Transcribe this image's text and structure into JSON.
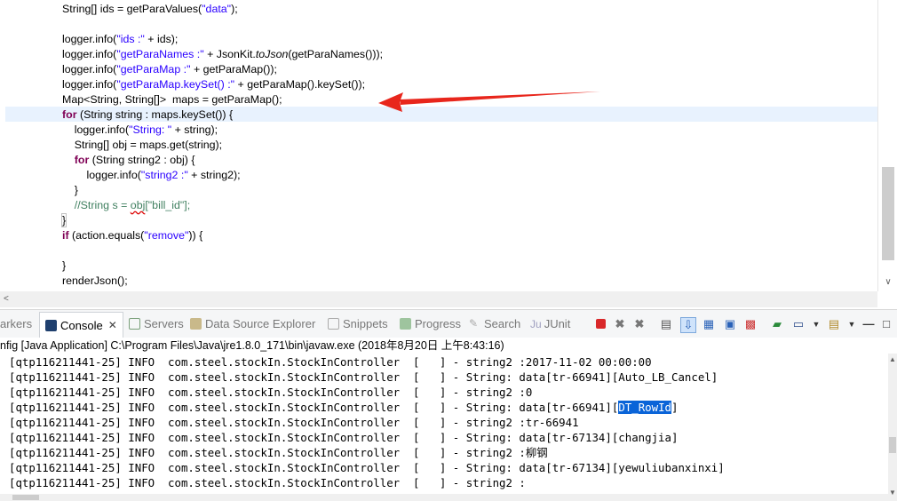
{
  "editor": {
    "lines": [
      "String[] ids = getParaValues(\"data\");",
      "",
      "logger.info(\"ids :\" + ids);",
      "logger.info(\"getParaNames :\" + JsonKit.toJson(getParaNames()));",
      "logger.info(\"getParaMap :\" + getParaMap());",
      "logger.info(\"getParaMap.keySet() :\" + getParaMap().keySet());",
      "Map<String, String[]>  maps = getParaMap();",
      "for (String string : maps.keySet()) {",
      "    logger.info(\"String: \" + string);",
      "    String[] obj = maps.get(string);",
      "    for (String string2 : obj) {",
      "        logger.info(\"string2 :\" + string2);",
      "    }",
      "    //String s = obj[\"bill_id\"];",
      "}",
      "if (action.equals(\"remove\")) {",
      "",
      "}",
      "renderJson();"
    ]
  },
  "tabs": {
    "markers": "arkers",
    "console": "Console",
    "servers": "Servers",
    "data_source_explorer": "Data Source Explorer",
    "snippets": "Snippets",
    "progress": "Progress",
    "search": "Search",
    "junit": "JUnit",
    "junit_icon_text": "Ju"
  },
  "console": {
    "title": "nfig [Java Application] C:\\Program Files\\Java\\jre1.8.0_171\\bin\\javaw.exe (2018年8月20日 上午8:43:16)",
    "lines": [
      "[qtp116211441-25] INFO  com.steel.stockIn.StockInController  [   ] - string2 :2017-11-02 00:00:00",
      "[qtp116211441-25] INFO  com.steel.stockIn.StockInController  [   ] - String: data[tr-66941][Auto_LB_Cancel]",
      "[qtp116211441-25] INFO  com.steel.stockIn.StockInController  [   ] - string2 :0",
      "[qtp116211441-25] INFO  com.steel.stockIn.StockInController  [   ] - String: data[tr-66941][",
      "[qtp116211441-25] INFO  com.steel.stockIn.StockInController  [   ] - string2 :tr-66941",
      "[qtp116211441-25] INFO  com.steel.stockIn.StockInController  [   ] - String: data[tr-67134][changjia]",
      "[qtp116211441-25] INFO  com.steel.stockIn.StockInController  [   ] - string2 :柳钢",
      "[qtp116211441-25] INFO  com.steel.stockIn.StockInController  [   ] - String: data[tr-67134][yewuliubanxinxi]",
      "[qtp116211441-25] INFO  com.steel.stockIn.StockInController  [   ] - string2 :"
    ],
    "selected_text": "DT_RowId",
    "selected_suffix": "]"
  },
  "colors": {
    "keyword": "#7f0055",
    "string": "#2a00ff",
    "comment": "#3f7f5f",
    "arrow": "#e8261c",
    "selection": "#0a64d8",
    "current_line": "#e8f2fe"
  },
  "icons": [
    "console-icon",
    "servers-icon",
    "data-source-icon",
    "snippets-icon",
    "progress-icon",
    "search-icon",
    "junit-icon",
    "terminate-icon",
    "remove-launch-icon",
    "remove-all-icon",
    "clear-console-icon",
    "scroll-lock-icon",
    "word-wrap-icon",
    "pin-console-icon",
    "display-console-icon",
    "open-console-icon",
    "minimize-icon",
    "maximize-icon"
  ]
}
